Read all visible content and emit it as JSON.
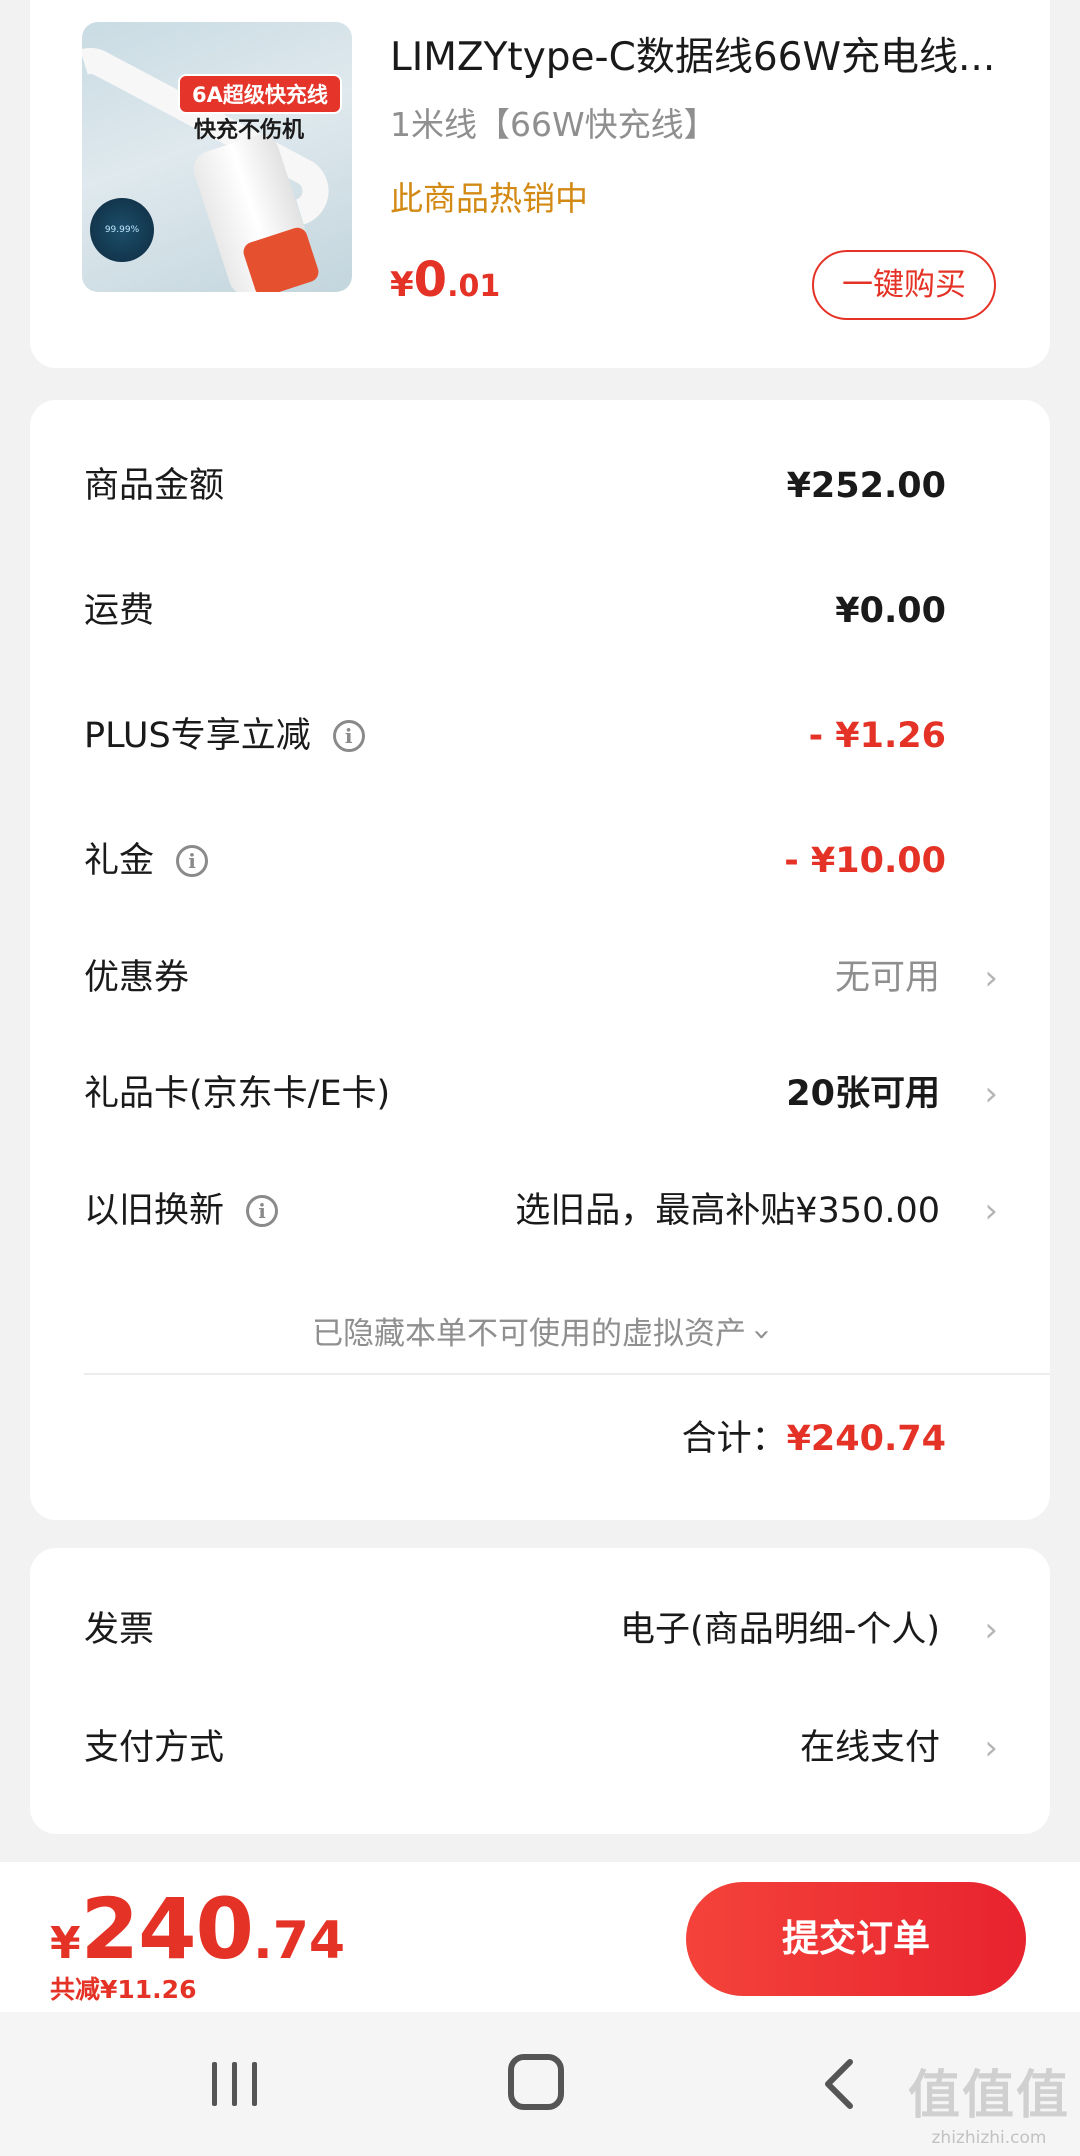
{
  "product": {
    "image_badge": "6A超级快充线",
    "image_tagline": "快充不伤机",
    "image_circle_text": "99.99%",
    "title": "LIMZYtype-C数据线66W充电线...",
    "spec": "1米线【66W快充线】",
    "hot_label": "此商品热销中",
    "price_currency": "¥",
    "price_int": "0",
    "price_dec": ".01",
    "buy_button": "一键购买"
  },
  "summary": {
    "rows": [
      {
        "label": "商品金额",
        "value": "¥252.00"
      },
      {
        "label": "运费",
        "value": "¥0.00"
      },
      {
        "label": "PLUS专享立减",
        "value": "- ¥1.26"
      },
      {
        "label": "礼金",
        "value": "- ¥10.00"
      },
      {
        "label": "优惠券",
        "value": "无可用"
      },
      {
        "label": "礼品卡(京东卡/E卡)",
        "value": "20张可用"
      },
      {
        "label": "以旧换新",
        "value": "选旧品，最高补贴¥350.00"
      }
    ],
    "hidden_assets_note": "已隐藏本单不可使用的虚拟资产",
    "total_label": "合计：",
    "total_value": "¥240.74"
  },
  "extra": {
    "rows": [
      {
        "label": "发票",
        "value": "电子(商品明细-个人)"
      },
      {
        "label": "支付方式",
        "value": "在线支付"
      }
    ]
  },
  "bottom_bar": {
    "currency": "¥",
    "price_int": "240",
    "price_dec": ".74",
    "saved": "共减¥11.26",
    "submit": "提交订单"
  },
  "watermark": {
    "main": "值值值",
    "url": "zhizhizhi.com"
  },
  "colors": {
    "accent_red": "#e53226",
    "hot_orange": "#d38a14",
    "background": "#f2f2f2"
  },
  "icons": [
    "info-icon",
    "chevron-right-icon",
    "chevron-down-icon",
    "recents-icon",
    "home-icon",
    "back-icon"
  ]
}
